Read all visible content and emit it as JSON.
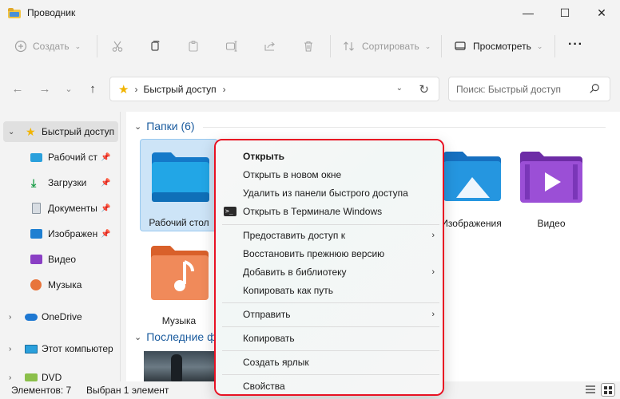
{
  "window": {
    "title": "Проводник",
    "minimize": "—",
    "maximize": "☐",
    "close": "✕"
  },
  "toolbar": {
    "create": "Создать",
    "sort": "Сортировать",
    "view": "Просмотреть",
    "more": "···"
  },
  "nav": {
    "back": "←",
    "forward": "→",
    "recent": "⌄",
    "up": "↑"
  },
  "address": {
    "path": "Быстрый доступ",
    "search_placeholder": "Поиск: Быстрый доступ"
  },
  "sidebar": {
    "items": [
      {
        "label": "Быстрый доступ",
        "icon": "star-icon",
        "selected": true
      },
      {
        "label": "Рабочий стол",
        "icon": "desktop-icon",
        "pinned": true
      },
      {
        "label": "Загрузки",
        "icon": "download-icon",
        "pinned": true
      },
      {
        "label": "Документы",
        "icon": "documents-icon",
        "pinned": true
      },
      {
        "label": "Изображения",
        "icon": "pictures-icon",
        "pinned": true
      },
      {
        "label": "Видео",
        "icon": "video-icon"
      },
      {
        "label": "Музыка",
        "icon": "music-icon"
      },
      {
        "label": "OneDrive",
        "icon": "onedrive-icon"
      },
      {
        "label": "Этот компьютер",
        "icon": "computer-icon"
      },
      {
        "label": "DVD",
        "icon": "dvd-icon"
      }
    ]
  },
  "main": {
    "folders_header": "Папки (6)",
    "recent_header": "Последние файлы",
    "tiles": [
      {
        "label": "Рабочий стол",
        "icon": "desktop-folder-icon",
        "selected": true
      },
      {
        "label": "Изображения",
        "icon": "pictures-folder-icon"
      },
      {
        "label": "Видео",
        "icon": "video-folder-icon"
      },
      {
        "label": "Музыка",
        "icon": "music-folder-icon"
      }
    ]
  },
  "context_menu": {
    "items": [
      {
        "label": "Открыть",
        "bold": true
      },
      {
        "label": "Открыть в новом окне"
      },
      {
        "label": "Удалить из панели быстрого доступа"
      },
      {
        "label": "Открыть в Терминале Windows",
        "icon": "terminal-icon"
      },
      {
        "label": "Предоставить доступ к",
        "submenu": true
      },
      {
        "label": "Восстановить прежнюю версию"
      },
      {
        "label": "Добавить в библиотеку",
        "submenu": true
      },
      {
        "label": "Копировать как путь"
      },
      {
        "label": "Отправить",
        "submenu": true
      },
      {
        "label": "Копировать"
      },
      {
        "label": "Создать ярлык"
      },
      {
        "label": "Свойства"
      }
    ],
    "highlight_color": "#e81123"
  },
  "status": {
    "count": "Элементов: 7",
    "selected": "Выбран 1 элемент"
  },
  "colors": {
    "accent": "#0067c0",
    "folder_blue": "#1f8bd6",
    "folder_purple": "#8a3fc4",
    "folder_orange": "#e8743b"
  }
}
